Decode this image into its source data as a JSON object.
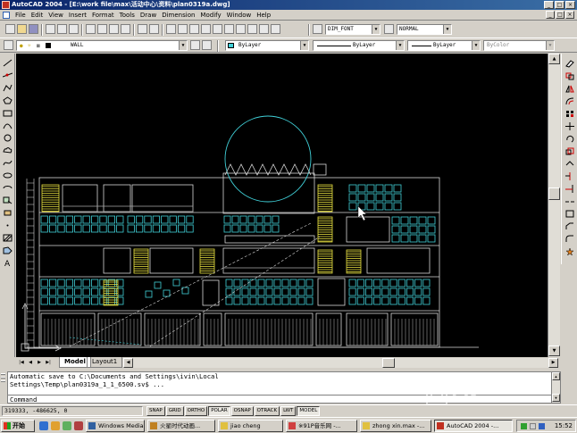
{
  "window": {
    "title": "AutoCAD 2004 - [E:\\work file\\max\\活动中心\\资料\\plan0319a.dwg]",
    "buttons": [
      "_",
      "□",
      "×"
    ]
  },
  "menu": {
    "items": [
      "File",
      "Edit",
      "View",
      "Insert",
      "Format",
      "Tools",
      "Draw",
      "Dimension",
      "Modify",
      "Window",
      "Help"
    ]
  },
  "toolbar": {
    "dimstyle": "DIM_FONT",
    "textstyle": "NORMAL",
    "layer": "WALL",
    "color": "ByLayer",
    "linetype": "ByLayer",
    "lineweight": "ByLayer",
    "plotstyle": "ByColor"
  },
  "tabs": {
    "model": "Model",
    "layout": "Layout1"
  },
  "command": {
    "history": [
      "Automatic save to C:\\Documents and Settings\\ivin\\Local",
      "Settings\\Temp\\plan0319a_1_1_6500.sv$ ..."
    ],
    "prompt": "Command"
  },
  "status": {
    "coords": "319333, -486625, 0",
    "modes": [
      {
        "label": "SNAP",
        "on": false
      },
      {
        "label": "GRID",
        "on": false
      },
      {
        "label": "ORTHO",
        "on": false
      },
      {
        "label": "POLAR",
        "on": true
      },
      {
        "label": "OSNAP",
        "on": false
      },
      {
        "label": "OTRACK",
        "on": false
      },
      {
        "label": "LWT",
        "on": false
      },
      {
        "label": "MODEL",
        "on": true
      }
    ]
  },
  "taskbar": {
    "start": "开始",
    "tasks": [
      {
        "label": "Windows Media P...",
        "active": false
      },
      {
        "label": "火星时代动画...",
        "active": false
      },
      {
        "label": "jiao cheng",
        "active": false
      },
      {
        "label": "※91P音乐网 -...",
        "active": false
      },
      {
        "label": "zhong xin.max -...",
        "active": false
      },
      {
        "label": "AutoCAD 2004 -...",
        "active": true
      }
    ],
    "clock": "15:52"
  },
  "canvas": {
    "background": "#000000",
    "accent_cyan": "#40d0d8",
    "accent_yellow": "#e8e040"
  },
  "watermark": "CG"
}
